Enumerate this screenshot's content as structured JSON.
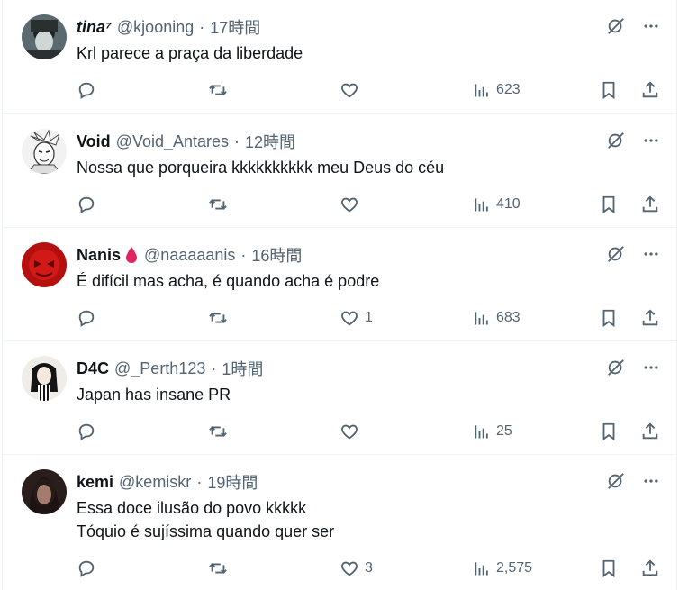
{
  "tweets": [
    {
      "name": "tina⁷",
      "handle": "@kjooning",
      "sep": "·",
      "time": "17時間",
      "text": "Krl parece a praça da liberdade",
      "replies": "",
      "retweets": "",
      "likes": "",
      "views": "623"
    },
    {
      "name": "Void",
      "handle": "@Void_Antares",
      "sep": "·",
      "time": "12時間",
      "text": "Nossa que porqueira kkkkkkkkkk meu Deus do céu",
      "replies": "",
      "retweets": "",
      "likes": "",
      "views": "410"
    },
    {
      "name": "Nanis",
      "handle": "@naaaaanis",
      "sep": "·",
      "time": "16時間",
      "text": "É difícil mas acha, é quando acha é podre",
      "replies": "",
      "retweets": "",
      "likes": "1",
      "views": "683"
    },
    {
      "name": "D4C",
      "handle": "@_Perth123",
      "sep": "·",
      "time": "1時間",
      "text": "Japan has insane PR",
      "replies": "",
      "retweets": "",
      "likes": "",
      "views": "25"
    },
    {
      "name": "kemi",
      "handle": "@kemiskr",
      "sep": "·",
      "time": "19時間",
      "text": "Essa doce ilusão do povo kkkkk\nTóquio é sujíssima quando quer ser",
      "replies": "",
      "retweets": "",
      "likes": "3",
      "views": "2,575"
    }
  ],
  "icons": {
    "reply": "reply-icon",
    "retweet": "retweet-icon",
    "like": "heart-icon",
    "views": "views-icon",
    "bookmark": "bookmark-icon",
    "share": "share-icon",
    "grok": "grok-icon",
    "more": "more-icon",
    "drop": "blood-drop-icon"
  },
  "colors": {
    "text": "#0f1419",
    "secondary": "#536471",
    "border": "#eff3f4",
    "drop": "#e0245e"
  }
}
